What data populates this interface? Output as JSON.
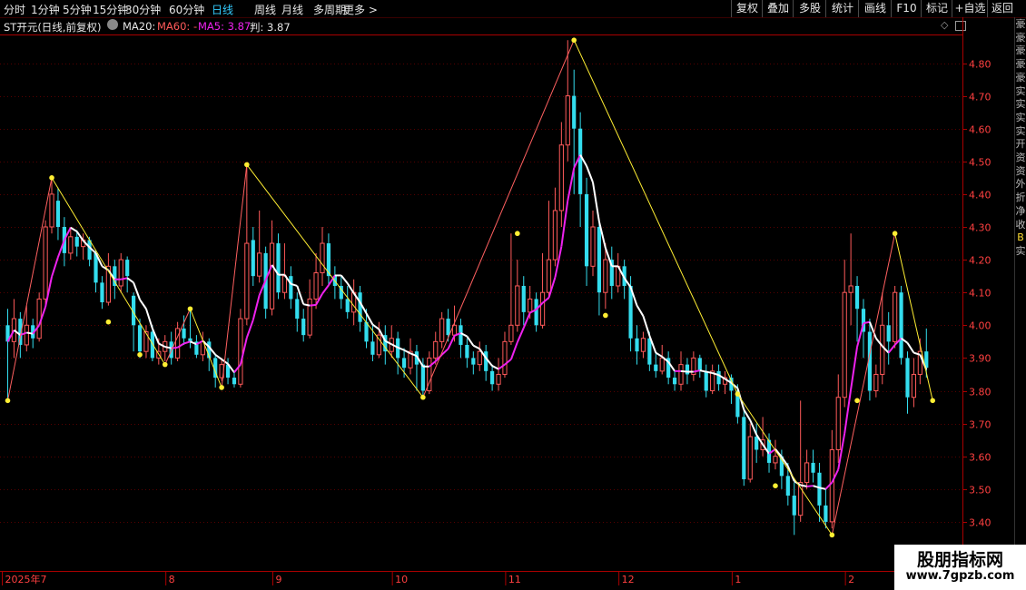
{
  "toolbar": {
    "timeframes": [
      "分时",
      "1分钟",
      "5分钟",
      "15分钟",
      "30分钟",
      "60分钟",
      "日线",
      "周线",
      "月线",
      "多周期",
      "更多 >"
    ],
    "active_timeframe": "日线",
    "buttons": [
      "复权",
      "叠加",
      "多股",
      "统计",
      "画线",
      "F10",
      "标记",
      "+自选",
      "返回"
    ]
  },
  "indicator": {
    "stock": "ST开元(日线,前复权)",
    "ma20": "MA20:",
    "ma60": "MA60: -",
    "ma5": "MA5: 3.87",
    "pan": "判: 3.87"
  },
  "right_panel_glyphs": [
    "豪",
    "豪",
    "豪",
    "豪",
    "豪",
    "实",
    "实",
    "实",
    "实",
    "开",
    "资",
    "资",
    "外",
    "折",
    "净",
    "收",
    "B",
    "实"
  ],
  "colors": {
    "up": "#ff5a5a",
    "down": "#33ddee",
    "ma_white": "#ffffff",
    "ma_magenta": "#ee22ee",
    "zig_up": "#ff6060",
    "zig_down": "#ffee33",
    "axis": "#aa0000",
    "grid": "#550000",
    "price_label": "#ff4040"
  },
  "chart_data": {
    "type": "candlestick",
    "y_ticks": [
      "4.80",
      "4.70",
      "4.60",
      "4.50",
      "4.40",
      "4.30",
      "4.20",
      "4.10",
      "4.00",
      "3.90",
      "3.80",
      "3.70",
      "3.60",
      "3.50",
      "3.40"
    ],
    "ylim": [
      3.35,
      4.87
    ],
    "x_labels": [
      "2025年7",
      "8",
      "9",
      "10",
      "11",
      "12",
      "1",
      "2"
    ],
    "label_days": [
      0,
      26,
      43,
      62,
      80,
      98,
      116,
      134
    ],
    "zigzag": [
      {
        "d": 0,
        "p": 3.77
      },
      {
        "d": 7,
        "p": 4.45
      },
      {
        "d": 25,
        "p": 3.88
      },
      {
        "d": 29,
        "p": 4.05
      },
      {
        "d": 34,
        "p": 3.81
      },
      {
        "d": 38,
        "p": 4.49
      },
      {
        "d": 66,
        "p": 3.78
      },
      {
        "d": 90,
        "p": 4.87
      },
      {
        "d": 116,
        "p": 3.79
      },
      {
        "d": 131,
        "p": 3.36
      },
      {
        "d": 141,
        "p": 4.28
      },
      {
        "d": 147,
        "p": 3.77
      }
    ],
    "extra_pivots": [
      {
        "d": 16,
        "p": 4.01
      },
      {
        "d": 21,
        "p": 3.91
      },
      {
        "d": 81,
        "p": 4.28
      },
      {
        "d": 95,
        "p": 4.03
      },
      {
        "d": 122,
        "p": 3.51
      },
      {
        "d": 135,
        "p": 3.77
      }
    ],
    "bars": [
      [
        4.0,
        3.95,
        4.05,
        3.77
      ],
      [
        3.95,
        4.02,
        4.08,
        3.9
      ],
      [
        4.02,
        3.94,
        4.04,
        3.9
      ],
      [
        3.94,
        4.0,
        4.06,
        3.92
      ],
      [
        4.0,
        3.96,
        4.02,
        3.93
      ],
      [
        3.96,
        4.08,
        4.1,
        3.95
      ],
      [
        4.08,
        4.3,
        4.32,
        4.06
      ],
      [
        4.3,
        4.4,
        4.45,
        4.28
      ],
      [
        4.38,
        4.3,
        4.42,
        4.26
      ],
      [
        4.3,
        4.22,
        4.33,
        4.18
      ],
      [
        4.22,
        4.27,
        4.3,
        4.2
      ],
      [
        4.27,
        4.24,
        4.29,
        4.21
      ],
      [
        4.24,
        4.26,
        4.28,
        4.2
      ],
      [
        4.26,
        4.2,
        4.27,
        4.18
      ],
      [
        4.22,
        4.13,
        4.23,
        4.1
      ],
      [
        4.13,
        4.07,
        4.15,
        4.05
      ],
      [
        4.07,
        4.18,
        4.22,
        4.06
      ],
      [
        4.18,
        4.12,
        4.2,
        4.08
      ],
      [
        4.12,
        4.2,
        4.22,
        4.1
      ],
      [
        4.2,
        4.15,
        4.21,
        4.1
      ],
      [
        4.09,
        4.0,
        4.1,
        3.92
      ],
      [
        4.0,
        3.92,
        4.02,
        3.9
      ],
      [
        3.92,
        3.98,
        4.0,
        3.9
      ],
      [
        3.98,
        3.9,
        4.0,
        3.89
      ],
      [
        3.9,
        3.92,
        3.96,
        3.88
      ],
      [
        3.92,
        3.95,
        3.97,
        3.89
      ],
      [
        3.95,
        3.9,
        3.98,
        3.88
      ],
      [
        3.9,
        3.99,
        4.01,
        3.89
      ],
      [
        3.99,
        3.96,
        4.03,
        3.94
      ],
      [
        3.96,
        3.95,
        4.05,
        3.93
      ],
      [
        3.95,
        3.91,
        3.97,
        3.9
      ],
      [
        3.91,
        3.95,
        3.98,
        3.89
      ],
      [
        3.95,
        3.9,
        3.96,
        3.86
      ],
      [
        3.9,
        3.84,
        3.91,
        3.81
      ],
      [
        3.84,
        3.88,
        3.9,
        3.83
      ],
      [
        3.88,
        3.84,
        3.9,
        3.82
      ],
      [
        3.84,
        3.82,
        3.86,
        3.81
      ],
      [
        3.82,
        4.02,
        4.05,
        3.81
      ],
      [
        4.02,
        4.25,
        4.49,
        4.0
      ],
      [
        4.26,
        4.15,
        4.3,
        4.12
      ],
      [
        4.15,
        4.22,
        4.35,
        4.13
      ],
      [
        4.22,
        4.05,
        4.24,
        4.02
      ],
      [
        4.05,
        4.25,
        4.32,
        4.03
      ],
      [
        4.25,
        4.1,
        4.28,
        4.08
      ],
      [
        4.1,
        4.15,
        4.25,
        4.08
      ],
      [
        4.15,
        4.08,
        4.18,
        4.05
      ],
      [
        4.08,
        4.02,
        4.1,
        3.98
      ],
      [
        4.02,
        3.97,
        4.05,
        3.95
      ],
      [
        3.97,
        4.08,
        4.14,
        3.96
      ],
      [
        4.08,
        4.16,
        4.22,
        4.05
      ],
      [
        4.16,
        4.25,
        4.3,
        4.12
      ],
      [
        4.25,
        4.15,
        4.28,
        4.12
      ],
      [
        4.15,
        4.12,
        4.18,
        4.08
      ],
      [
        4.12,
        4.08,
        4.15,
        4.05
      ],
      [
        4.08,
        4.04,
        4.12,
        4.02
      ],
      [
        4.04,
        4.1,
        4.14,
        4.0
      ],
      [
        4.1,
        4.01,
        4.12,
        3.98
      ],
      [
        4.01,
        3.95,
        4.05,
        3.93
      ],
      [
        3.95,
        3.91,
        4.0,
        3.89
      ],
      [
        3.91,
        3.97,
        4.01,
        3.9
      ],
      [
        3.97,
        3.92,
        4.0,
        3.88
      ],
      [
        3.92,
        3.96,
        4.0,
        3.9
      ],
      [
        3.96,
        3.9,
        3.98,
        3.85
      ],
      [
        3.9,
        3.87,
        3.93,
        3.84
      ],
      [
        3.87,
        3.92,
        3.96,
        3.85
      ],
      [
        3.92,
        3.88,
        3.94,
        3.8
      ],
      [
        3.88,
        3.8,
        3.9,
        3.78
      ],
      [
        3.8,
        3.9,
        3.92,
        3.79
      ],
      [
        3.9,
        3.95,
        3.98,
        3.88
      ],
      [
        3.95,
        4.02,
        4.04,
        3.93
      ],
      [
        4.02,
        3.97,
        4.05,
        3.95
      ],
      [
        3.97,
        4.0,
        4.06,
        3.95
      ],
      [
        4.0,
        3.94,
        4.02,
        3.9
      ],
      [
        3.94,
        3.9,
        3.96,
        3.87
      ],
      [
        3.9,
        3.88,
        3.92,
        3.85
      ],
      [
        3.88,
        3.92,
        3.95,
        3.86
      ],
      [
        3.92,
        3.86,
        3.94,
        3.83
      ],
      [
        3.86,
        3.82,
        3.88,
        3.8
      ],
      [
        3.82,
        3.85,
        3.9,
        3.8
      ],
      [
        3.85,
        3.95,
        3.98,
        3.84
      ],
      [
        3.95,
        4.0,
        4.28,
        3.94
      ],
      [
        4.0,
        4.12,
        4.2,
        3.98
      ],
      [
        4.12,
        4.04,
        4.15,
        4.0
      ],
      [
        4.04,
        4.08,
        4.12,
        4.02
      ],
      [
        4.08,
        4.0,
        4.1,
        3.98
      ],
      [
        4.0,
        4.1,
        4.22,
        3.99
      ],
      [
        4.1,
        4.2,
        4.38,
        4.08
      ],
      [
        4.2,
        4.35,
        4.42,
        4.18
      ],
      [
        4.35,
        4.55,
        4.62,
        4.3
      ],
      [
        4.55,
        4.7,
        4.87,
        4.5
      ],
      [
        4.7,
        4.6,
        4.78,
        4.4
      ],
      [
        4.6,
        4.4,
        4.65,
        4.3
      ],
      [
        4.4,
        4.18,
        4.45,
        4.12
      ],
      [
        4.18,
        4.3,
        4.35,
        4.15
      ],
      [
        4.3,
        4.1,
        4.32,
        4.03
      ],
      [
        4.1,
        4.2,
        4.25,
        4.05
      ],
      [
        4.2,
        4.12,
        4.24,
        4.08
      ],
      [
        4.12,
        4.18,
        4.22,
        4.1
      ],
      [
        4.18,
        4.12,
        4.2,
        4.08
      ],
      [
        4.12,
        3.96,
        4.15,
        3.92
      ],
      [
        3.96,
        3.92,
        4.0,
        3.88
      ],
      [
        3.92,
        3.96,
        3.98,
        3.9
      ],
      [
        3.96,
        3.88,
        3.98,
        3.86
      ],
      [
        3.88,
        3.86,
        3.92,
        3.84
      ],
      [
        3.86,
        3.9,
        3.94,
        3.85
      ],
      [
        3.9,
        3.84,
        3.92,
        3.82
      ],
      [
        3.84,
        3.82,
        3.86,
        3.8
      ],
      [
        3.82,
        3.88,
        3.92,
        3.8
      ],
      [
        3.88,
        3.85,
        3.9,
        3.82
      ],
      [
        3.85,
        3.9,
        3.92,
        3.83
      ],
      [
        3.9,
        3.86,
        3.91,
        3.84
      ],
      [
        3.86,
        3.8,
        3.88,
        3.78
      ],
      [
        3.8,
        3.86,
        3.88,
        3.79
      ],
      [
        3.86,
        3.82,
        3.88,
        3.8
      ],
      [
        3.82,
        3.84,
        3.86,
        3.79
      ],
      [
        3.84,
        3.8,
        3.85,
        3.76
      ],
      [
        3.8,
        3.72,
        3.82,
        3.7
      ],
      [
        3.72,
        3.53,
        3.74,
        3.51
      ],
      [
        3.53,
        3.66,
        3.7,
        3.52
      ],
      [
        3.66,
        3.62,
        3.7,
        3.58
      ],
      [
        3.62,
        3.65,
        3.72,
        3.6
      ],
      [
        3.65,
        3.58,
        3.67,
        3.55
      ],
      [
        3.58,
        3.6,
        3.65,
        3.56
      ],
      [
        3.6,
        3.54,
        3.62,
        3.5
      ],
      [
        3.54,
        3.48,
        3.58,
        3.45
      ],
      [
        3.48,
        3.42,
        3.52,
        3.36
      ],
      [
        3.42,
        3.52,
        3.77,
        3.4
      ],
      [
        3.52,
        3.58,
        3.62,
        3.5
      ],
      [
        3.58,
        3.55,
        3.62,
        3.52
      ],
      [
        3.55,
        3.45,
        3.58,
        3.4
      ],
      [
        3.45,
        3.4,
        3.5,
        3.38
      ],
      [
        3.4,
        3.62,
        3.68,
        3.38
      ],
      [
        3.62,
        3.78,
        3.85,
        3.58
      ],
      [
        3.78,
        4.1,
        4.2,
        3.75
      ],
      [
        4.1,
        4.12,
        4.28,
        4.0
      ],
      [
        4.12,
        4.05,
        4.15,
        3.95
      ],
      [
        4.05,
        3.98,
        4.08,
        3.9
      ],
      [
        3.98,
        3.8,
        4.02,
        3.77
      ],
      [
        3.8,
        3.85,
        3.88,
        3.78
      ],
      [
        3.85,
        4.0,
        4.1,
        3.82
      ],
      [
        4.0,
        3.95,
        4.04,
        3.88
      ],
      [
        3.95,
        4.1,
        4.12,
        3.93
      ],
      [
        4.1,
        3.9,
        4.12,
        3.88
      ],
      [
        3.9,
        3.78,
        3.92,
        3.73
      ],
      [
        3.78,
        3.85,
        3.9,
        3.75
      ],
      [
        3.85,
        3.92,
        3.96,
        3.82
      ],
      [
        3.92,
        3.87,
        3.99,
        3.84
      ]
    ]
  },
  "watermark": {
    "title": "股朋指标网",
    "url": "www.7gpzb.com"
  }
}
